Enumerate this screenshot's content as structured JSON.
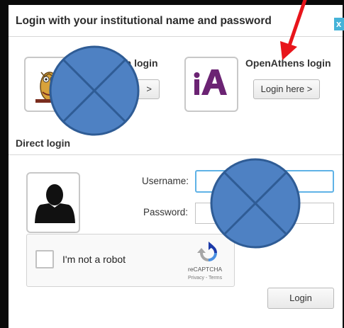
{
  "dialog": {
    "title": "Login with your institutional name and password",
    "close_label": "x"
  },
  "options": [
    {
      "title": "th login",
      "button_label": ">",
      "icon": "owl-crest-icon"
    },
    {
      "title": "OpenAthens login",
      "button_label": "Login here >",
      "icon": "openathens-logo-icon"
    }
  ],
  "direct_login": {
    "title": "Direct login",
    "username_label": "Username:",
    "username_value": "",
    "password_label": "Password:",
    "password_value": "",
    "submit_label": "Login",
    "avatar_icon": "user-silhouette-icon"
  },
  "captcha": {
    "label": "I'm not a robot",
    "brand": "reCAPTCHA",
    "terms": "Privacy - Terms",
    "checked": false
  },
  "annotations": {
    "arrow_color": "#e8151b",
    "redaction_color": "#4e81c3"
  },
  "colors": {
    "close_button": "#45b3d8",
    "focus_border": "#5fb2e6",
    "openathens_purple": "#6b2373"
  }
}
